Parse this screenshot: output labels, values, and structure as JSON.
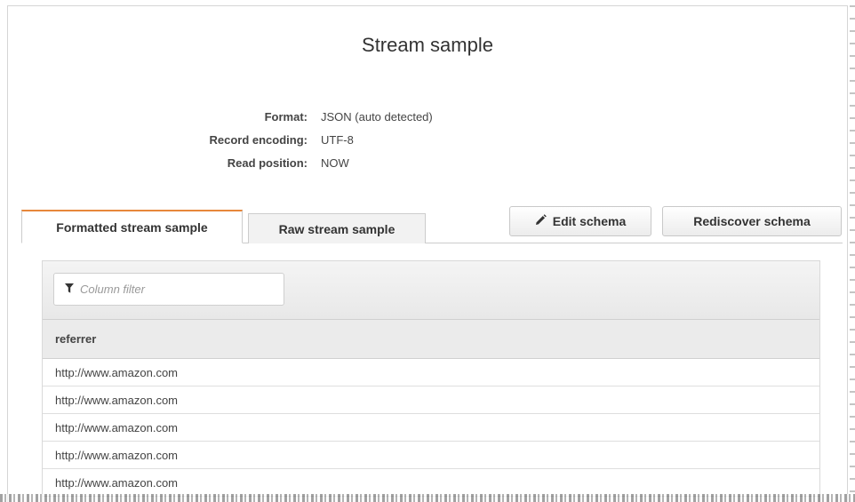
{
  "title": "Stream sample",
  "meta": [
    {
      "label": "Format:",
      "value": "JSON (auto detected)"
    },
    {
      "label": "Record encoding:",
      "value": "UTF-8"
    },
    {
      "label": "Read position:",
      "value": "NOW"
    }
  ],
  "tabs": {
    "formatted": "Formatted stream sample",
    "raw": "Raw stream sample"
  },
  "buttons": {
    "edit_schema": "Edit schema",
    "rediscover_schema": "Rediscover schema",
    "edit_icon": "pencil-icon"
  },
  "filter": {
    "placeholder": "Column filter",
    "icon": "filter-icon"
  },
  "table": {
    "columns": [
      "referrer"
    ],
    "rows": [
      "http://www.amazon.com",
      "http://www.amazon.com",
      "http://www.amazon.com",
      "http://www.amazon.com",
      "http://www.amazon.com"
    ]
  },
  "colors": {
    "active_tab_accent": "#e7873b"
  }
}
